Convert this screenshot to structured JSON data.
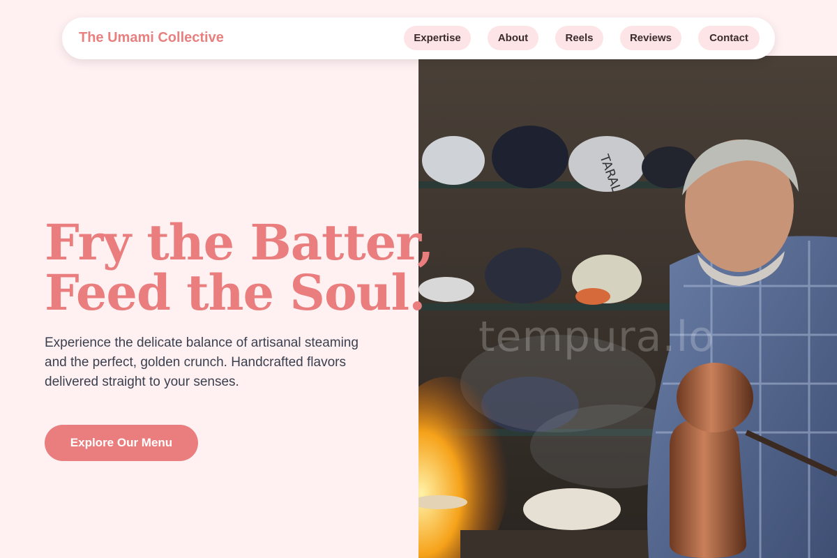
{
  "nav": {
    "brand": "The Umami Collective",
    "links": [
      {
        "label": "Expertise"
      },
      {
        "label": "About"
      },
      {
        "label": "Reels"
      },
      {
        "label": "Reviews"
      },
      {
        "label": "Contact"
      }
    ]
  },
  "hero": {
    "headline_line1": "Fry the Batter,",
    "headline_line2": "Feed the Soul.",
    "subtext": "Experience the delicate balance of artisanal steaming and the perfect, golden crunch. Handcrafted flavors delivered straight to your senses.",
    "cta_label": "Explore Our Menu",
    "image": {
      "watermark": "tempura.lo",
      "bag_label": "TARAL"
    }
  },
  "colors": {
    "background": "#fff1f2",
    "accent": "#ea7e7e",
    "nav_pill": "#fde4e6",
    "body_text": "#3a3f4e"
  }
}
